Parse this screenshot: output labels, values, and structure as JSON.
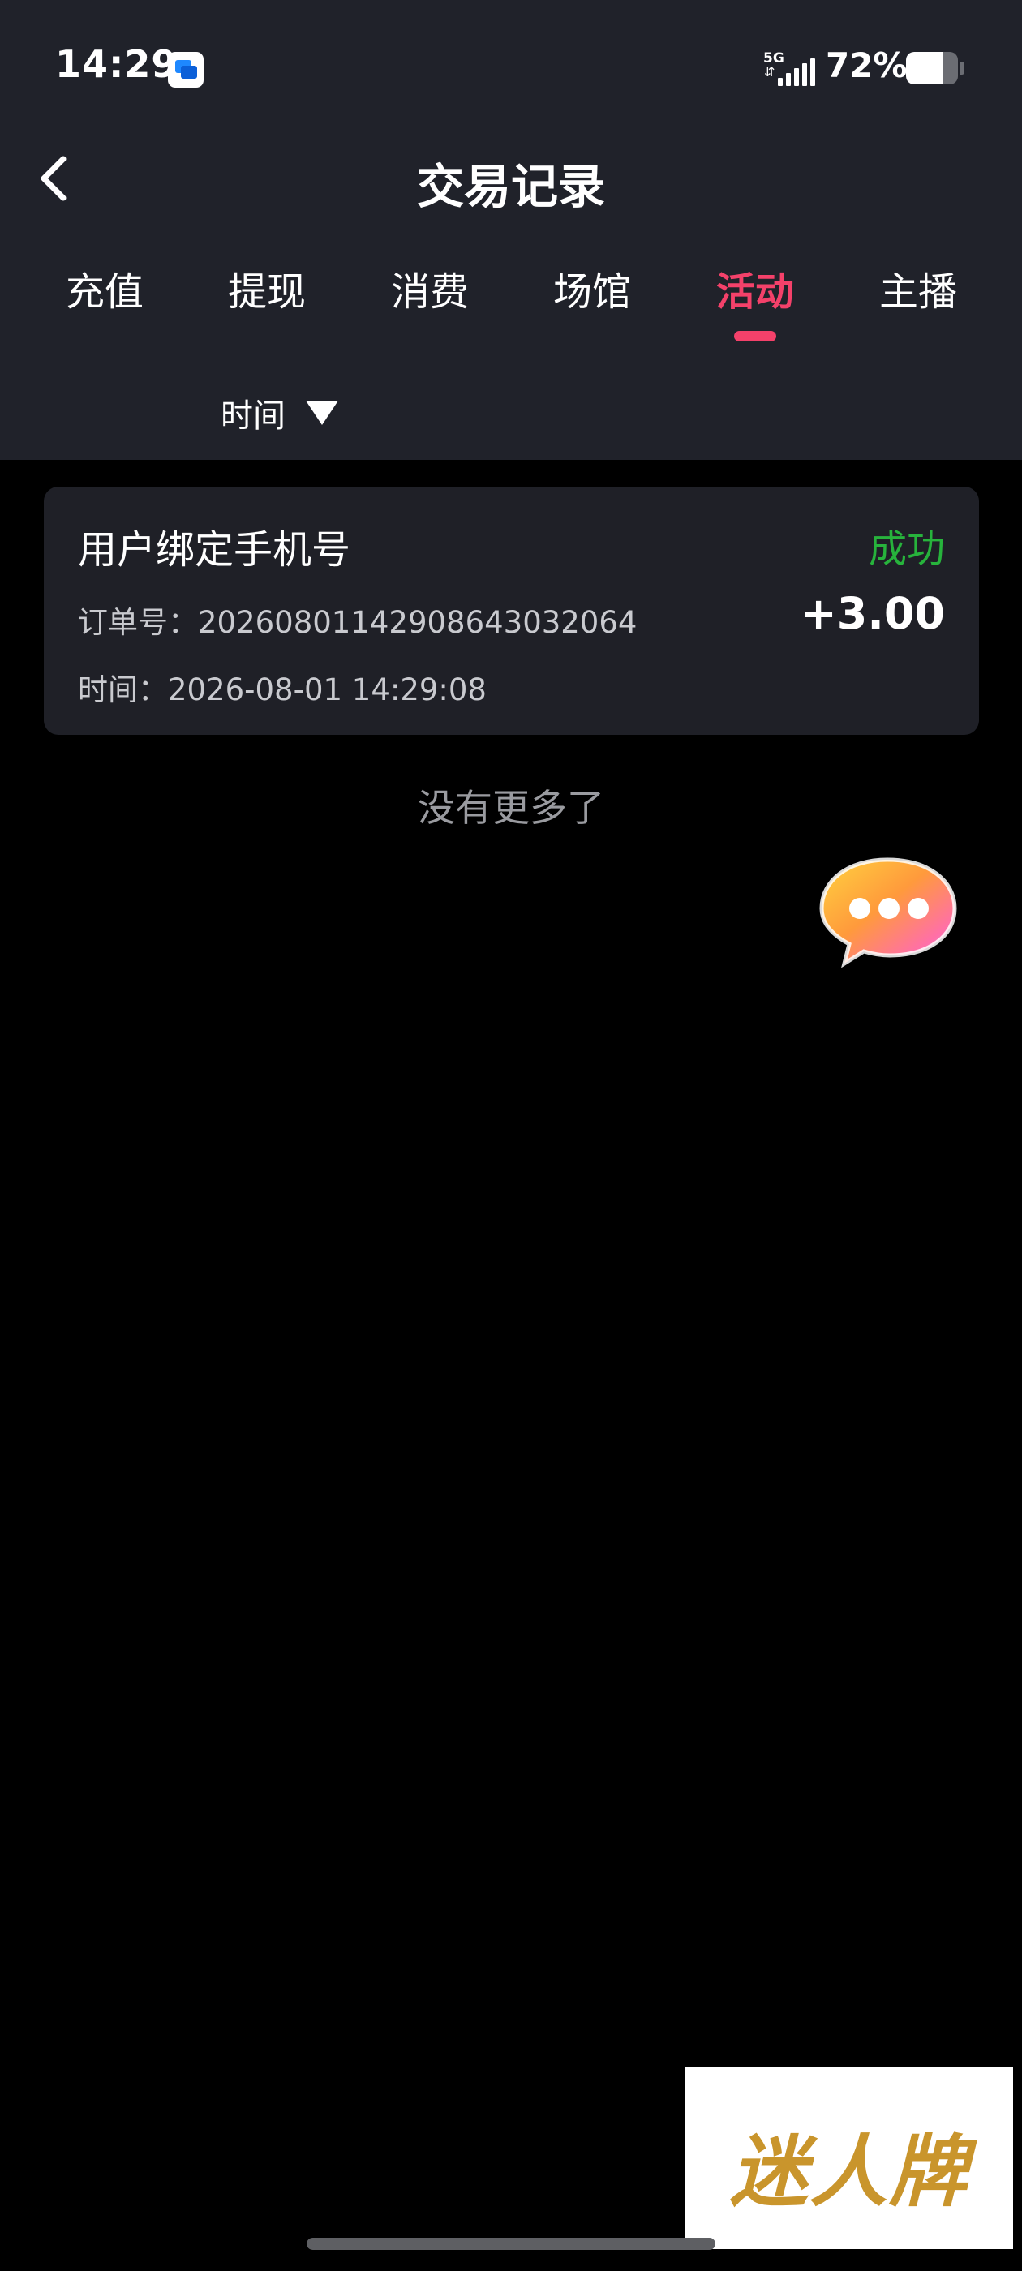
{
  "status_bar": {
    "time": "14:29",
    "network": "5G",
    "battery_text": "72%",
    "battery_level": 0.72,
    "app_icon": "messages-app-icon"
  },
  "header": {
    "title": "交易记录",
    "back_icon": "chevron-left-icon",
    "tabs": [
      {
        "label": "充值",
        "active": false
      },
      {
        "label": "提现",
        "active": false
      },
      {
        "label": "消费",
        "active": false
      },
      {
        "label": "场馆",
        "active": false
      },
      {
        "label": "活动",
        "active": true
      },
      {
        "label": "主播",
        "active": false
      }
    ],
    "filter_label": "时间",
    "filter_icon": "triangle-down-icon"
  },
  "records": [
    {
      "title": "用户绑定手机号",
      "status": "成功",
      "order_no": "订单号：20260801142908643032064",
      "amount": "+3.00",
      "time": "时间：2026-08-01 14:29:08"
    }
  ],
  "list_end_text": "没有更多了",
  "chat_button_icon": "chat-bubble-icon",
  "watermark_text": "迷人牌",
  "colors": {
    "background": "#000000",
    "header_bg": "#20222a",
    "card_bg": "#1f2027",
    "accent": "#f4416a",
    "success": "#27b33c",
    "muted": "#9a9ba0"
  }
}
